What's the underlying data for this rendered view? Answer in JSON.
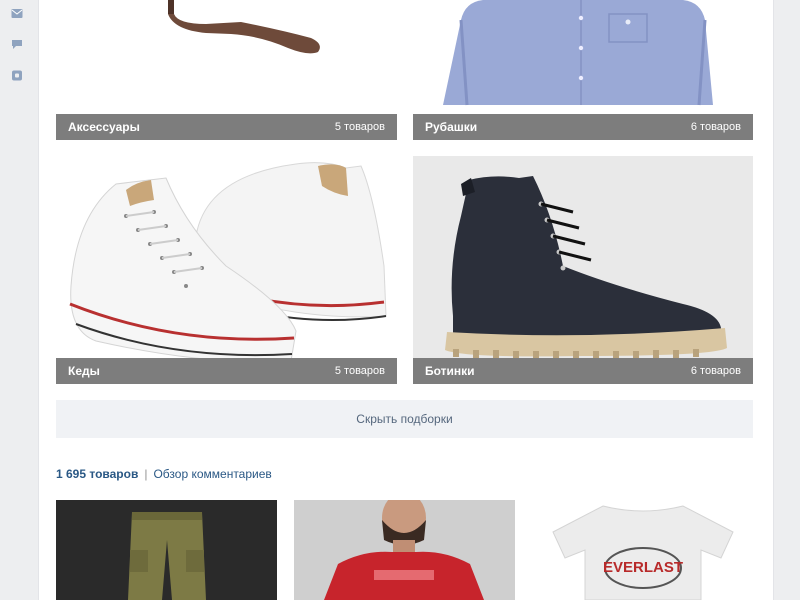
{
  "sidebar": {
    "icons": [
      "mail-icon",
      "chat-icon",
      "gear-icon"
    ]
  },
  "collections": [
    {
      "name": "Аксессуары",
      "count": "5 товаров"
    },
    {
      "name": "Рубашки",
      "count": "6 товаров"
    },
    {
      "name": "Кеды",
      "count": "5 товаров"
    },
    {
      "name": "Ботинки",
      "count": "6 товаров"
    }
  ],
  "hide_button": "Скрыть подборки",
  "products_meta": {
    "count": "1 695 товаров",
    "separator": "|",
    "comments_link": "Обзор комментариев"
  },
  "product_items": [
    {
      "image": "cargo-pants-image"
    },
    {
      "image": "red-tshirt-man-image"
    },
    {
      "image": "everlast-tshirt-image",
      "print_text": "EVERLAST"
    }
  ],
  "colors": {
    "link": "#2a5885",
    "bar": "#7d7d7d",
    "button_bg": "#f0f2f5"
  }
}
